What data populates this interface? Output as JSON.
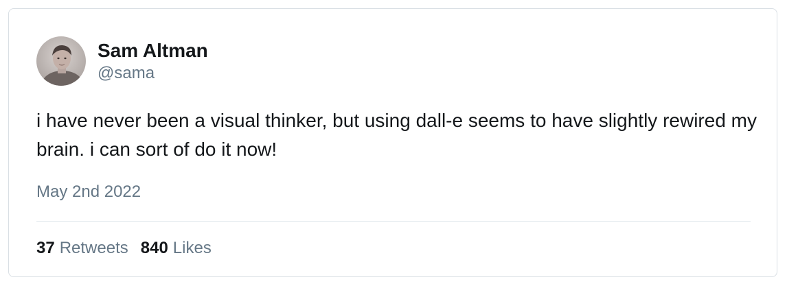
{
  "author": {
    "name": "Sam Altman",
    "handle": "@sama",
    "avatar": "user-avatar-photo"
  },
  "tweet": {
    "text": "i have never been a visual thinker, but using dall-e seems to have slightly rewired my brain. i can sort of do it now!",
    "date": "May 2nd 2022"
  },
  "stats": {
    "retweets_count": "37",
    "retweets_label": "Retweets",
    "likes_count": "840",
    "likes_label": "Likes"
  },
  "colors": {
    "text_primary": "#14171a",
    "text_secondary": "#657786",
    "border": "#d9dfe4",
    "divider": "#e1e8ed"
  }
}
